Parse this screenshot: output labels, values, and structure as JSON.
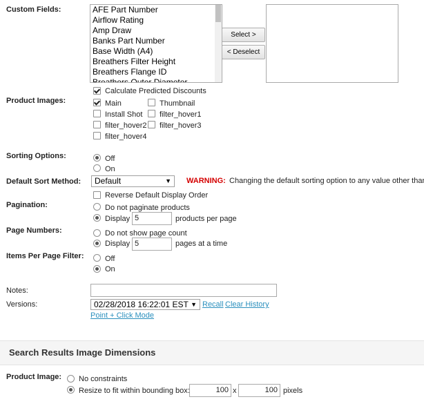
{
  "custom_fields": {
    "label": "Custom Fields:",
    "options": [
      "AFE Part Number",
      "Airflow Rating",
      "Amp Draw",
      "Banks Part Number",
      "Base Width (A4)",
      "Breathers Filter Height",
      "Breathers Flange ID",
      "Breathers Outer Diameter"
    ],
    "select_button": "Select >",
    "deselect_button": "< Deselect"
  },
  "calc_discounts": {
    "label": "Calculate Predicted Discounts",
    "checked": true
  },
  "product_images": {
    "label": "Product Images:",
    "items": [
      {
        "label": "Main",
        "checked": true
      },
      {
        "label": "Thumbnail",
        "checked": false
      },
      {
        "label": "Install Shot",
        "checked": false
      },
      {
        "label": "filter_hover1",
        "checked": false
      },
      {
        "label": "filter_hover2",
        "checked": false
      },
      {
        "label": "filter_hover3",
        "checked": false
      },
      {
        "label": "filter_hover4",
        "checked": false
      }
    ]
  },
  "sorting_options": {
    "label": "Sorting Options:",
    "off": "Off",
    "on": "On",
    "selected": "Off"
  },
  "default_sort": {
    "label": "Default Sort Method:",
    "value": "Default",
    "warning_label": "WARNING:",
    "warning_text": "Changing the default sorting option to any value other than"
  },
  "reverse_order": {
    "label": "Reverse Default Display Order",
    "checked": false
  },
  "pagination": {
    "label": "Pagination:",
    "no_paginate": "Do not paginate products",
    "display": "Display",
    "per_page_value": "5",
    "per_page_suffix": "products per page",
    "selected": "display"
  },
  "page_numbers": {
    "label": "Page Numbers:",
    "no_show": "Do not show page count",
    "display": "Display",
    "value": "5",
    "suffix": "pages at a time",
    "selected": "display"
  },
  "items_per_page_filter": {
    "label": "Items Per Page Filter:",
    "off": "Off",
    "on": "On",
    "selected": "On"
  },
  "notes": {
    "label": "Notes:",
    "value": ""
  },
  "versions": {
    "label": "Versions:",
    "value": "02/28/2018 16:22:01 EST",
    "recall": "Recall",
    "clear_history": "Clear History",
    "point_click": "Point + Click Mode"
  },
  "search_results": {
    "title": "Search Results Image Dimensions",
    "product_image_label": "Product Image:",
    "no_constraints": "No constraints",
    "resize_label": "Resize to fit within bounding box:",
    "width": "100",
    "x": "x",
    "height": "100",
    "pixels": "pixels",
    "selected": "resize"
  },
  "colors": {
    "link": "#2a8fbd",
    "warning": "#d40000"
  }
}
